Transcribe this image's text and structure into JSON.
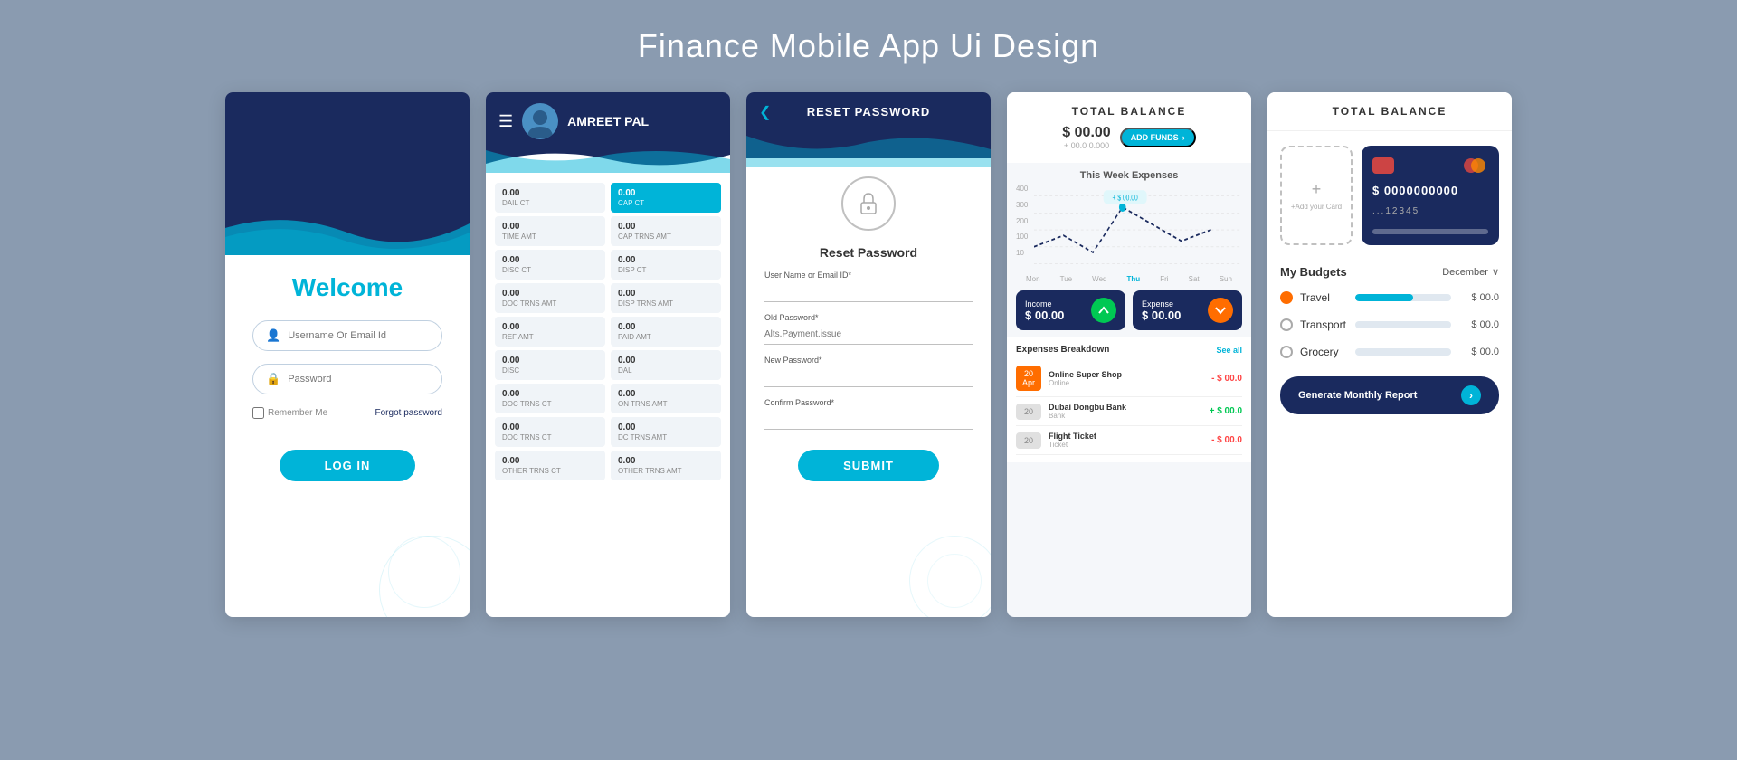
{
  "page": {
    "title": "Finance Mobile App Ui Design",
    "bg_color": "#8a9bb0"
  },
  "screen1": {
    "welcome": "Welcome",
    "username_placeholder": "Username Or Email Id",
    "password_placeholder": "Password",
    "remember_label": "Remember Me",
    "forgot_label": "Forgot password",
    "login_btn": "LOG IN"
  },
  "screen2": {
    "user_name": "AMREET PAL",
    "col1": {
      "rows": [
        {
          "value": "0.00",
          "label": "DAIL CT"
        },
        {
          "value": "0.00",
          "label": "TIME AMT"
        },
        {
          "value": "0.00",
          "label": "DISC CT"
        },
        {
          "value": "0.00",
          "label": "DOC TRNS AMT"
        },
        {
          "value": "0.00",
          "label": "REF AMT"
        },
        {
          "value": "0.00",
          "label": "DISC"
        },
        {
          "value": "0.00",
          "label": "DOC TRNS CT"
        },
        {
          "value": "0.00",
          "label": "DOC TRNS CT"
        },
        {
          "value": "0.00",
          "label": "OTHER TRNS CT"
        }
      ]
    },
    "col2": {
      "rows": [
        {
          "value": "0.00",
          "label": "CAP CT",
          "active": true
        },
        {
          "value": "0.00",
          "label": "CAP TRNS AMT"
        },
        {
          "value": "0.00",
          "label": "DISP CT"
        },
        {
          "value": "0.00",
          "label": "DISP TRNS AMT"
        },
        {
          "value": "0.00",
          "label": "PAID AMT"
        },
        {
          "value": "0.00",
          "label": "DAL"
        },
        {
          "value": "0.00",
          "label": "ON TRNS AMT"
        },
        {
          "value": "0.00",
          "label": "DC TRNS AMT"
        },
        {
          "value": "0.00",
          "label": "OTHER TRNS AMT"
        }
      ]
    }
  },
  "screen3": {
    "title": "RESET PASSWORD",
    "subtitle": "Reset Password",
    "username_label": "User Name or Email ID*",
    "username_placeholder": "",
    "old_password_label": "Old Password*",
    "old_password_placeholder": "Alts.Payment.issue",
    "new_password_label": "New Password*",
    "new_password_placeholder": "",
    "confirm_password_label": "Confirm Password*",
    "confirm_password_placeholder": "",
    "submit_btn": "SUBMIT"
  },
  "screen4": {
    "title": "TOTAL BALANCE",
    "balance_currency": "$ 00.00",
    "balance_sub": "+ 00.0 0.000",
    "add_funds_btn": "ADD FUNDS",
    "this_week": "This Week Expenses",
    "chart": {
      "y_labels": [
        "400",
        "300",
        "200",
        "100",
        "10"
      ],
      "x_labels": [
        "Mon",
        "Tue",
        "Wed",
        "Thu",
        "Fri",
        "Sat",
        "Sun"
      ],
      "active_day": "Thu",
      "tooltip_value": "+ $ 00.00"
    },
    "income_label": "Income",
    "income_amount": "$ 00.00",
    "expense_label": "Expense",
    "expense_amount": "$ 00.00",
    "breakdown_title": "Expenses Breakdown",
    "see_all": "See all",
    "breakdown_items": [
      {
        "date": "20",
        "month": "Apr",
        "name": "Online Super Shop",
        "sub": "Online",
        "amount": "- $ 00.0",
        "type": "negative",
        "color": "orange"
      },
      {
        "date": "20",
        "month": "",
        "name": "Dubai Dongbu Bank",
        "sub": "Bank",
        "amount": "+ $ 00.0",
        "type": "positive",
        "color": "gray"
      },
      {
        "date": "20",
        "month": "",
        "name": "Flight Ticket",
        "sub": "Ticket",
        "amount": "- $ 00.0",
        "type": "negative",
        "color": "gray"
      }
    ]
  },
  "screen5": {
    "title": "TOTAL BALANCE",
    "card_number": "$ 0000000000",
    "card_dots": "...12345",
    "add_card_label": "+Add your Card",
    "my_budgets_label": "My Budgets",
    "month_dropdown": "December",
    "budget_items": [
      {
        "label": "Travel",
        "amount": "$ 00.0",
        "bar_pct": 60,
        "dot": "orange"
      },
      {
        "label": "Transport",
        "amount": "$ 00.0",
        "bar_pct": 0,
        "dot": "gray"
      },
      {
        "label": "Grocery",
        "amount": "$ 00.0",
        "bar_pct": 0,
        "dot": "gray"
      }
    ],
    "generate_btn": "Generate Monthly Report"
  }
}
